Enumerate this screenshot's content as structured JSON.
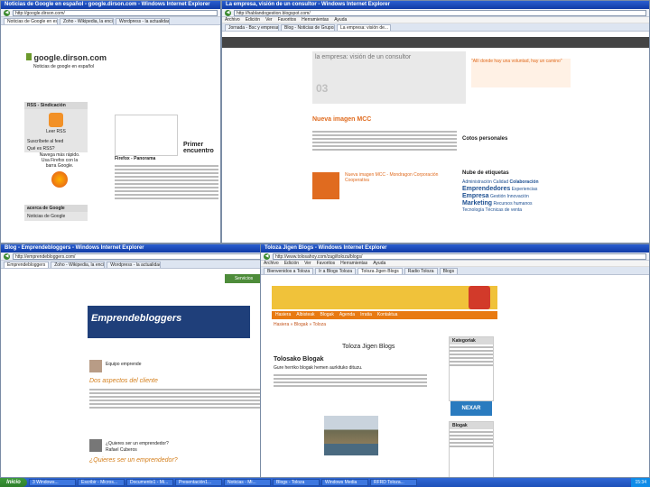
{
  "win1": {
    "title": "Noticias de Google en español - google.dirson.com - Windows Internet Explorer",
    "address": "http://google.dirson.com/",
    "tabs": [
      "Noticias de Google en español",
      "Zoho - Wikipedia, la enciclopedia",
      "Wordpress - la actualidad"
    ],
    "site_name": "google.dirson.com",
    "site_tagline": "Noticias de google en español",
    "rss_heading": "RSS - Sindicación",
    "rss_label": "Leer RSS",
    "rss_items": [
      "Suscríbete al feed",
      "Qué es RSS?"
    ],
    "firefox_text": "Navega más rápido. Usa Firefox con la barra Google.",
    "article_title": "Primer encuentro",
    "article_lead": "Firefox - Panorama",
    "section_title": "acerca de Google",
    "section_item": "Noticias de Google"
  },
  "win2": {
    "title": "La empresa, visión de un consultor - Windows Internet Explorer",
    "address": "http://hablandogestion.blogspot.com/",
    "tabs": [
      "Jornada - Bsc y empresa en...",
      "Blog - Noticias de Grupos Infoso...",
      "La empresa: visión de..."
    ],
    "blog_title": "la empresa: visión de un consultor",
    "post_title": "Nueva imagen MCC",
    "quote": "\"Allí donde hay una voluntad, hay un camino\"",
    "sidebar_title1": "Cotos personales",
    "sidebar_title2": "Nube de etiquetas",
    "tags": [
      "Administración",
      "Calidad",
      "Colaboración",
      "Emprendedores",
      "Experiencias",
      "Empresa",
      "Gestión",
      "Innovación",
      "Marketing",
      "Recursos humanos",
      "Tecnología",
      "Técnicas de venta"
    ],
    "caption": "Nueva imagen MCC - Mondragon Corporación Cooperativa",
    "date": "03"
  },
  "win3": {
    "title": "Blog - Emprendebloggers - Windows Internet Explorer",
    "address": "http://emprendebloggers.com/",
    "tabs": [
      "Emprendebloggers",
      "Zoho - Wikipedia, la enciclopedia",
      "Wordpress - la actualidad"
    ],
    "logo_text": "Emprendebloggers",
    "post1_title": "Dos aspectos del cliente",
    "post1_author": "Equipo emprende",
    "post2_title": "¿Quieres ser un emprendedor?",
    "post2_author": "Rafael Cuberos",
    "post3_title": "¿Quieres ser un emprendedor?",
    "sidebar_label": "Servicios"
  },
  "win4": {
    "title": "Toloza Jigen Blogs - Windows Internet Explorer",
    "address": "http://www.tolosahoy.com/zagi/toloza/blogs/",
    "tabs": [
      "Bienvenidos a Toloza",
      "Ir a Blogs Toloza",
      "Toloza Jigen Blogs",
      "Radio Toloza",
      "Blogs"
    ],
    "nav": [
      "Hasiera",
      "Albisteak",
      "Blogak",
      "Agenda",
      "Irratia",
      "Kontaktua"
    ],
    "breadcrumb": "Hasiera » Blogak » Toloza",
    "page_title": "Toloza Jigen Blogs",
    "post_title": "Tolosako Blogak",
    "intro": "Gure herriko blogak hemen aurkituko dituzu.",
    "sidebar_title1": "Kategoriak",
    "sidebar_title2": "Blogak",
    "badge": "NEXAR"
  },
  "taskbar": {
    "start": "Inicio",
    "items": [
      "3 Windows...",
      "Escribir - Micros...",
      "Documento1 - Mi...",
      "Presentación1...",
      "Noticias - Mi...",
      "Blogs - Toloza",
      "Windows Media",
      "RFRD Toloza..."
    ],
    "clock": "15:34"
  }
}
